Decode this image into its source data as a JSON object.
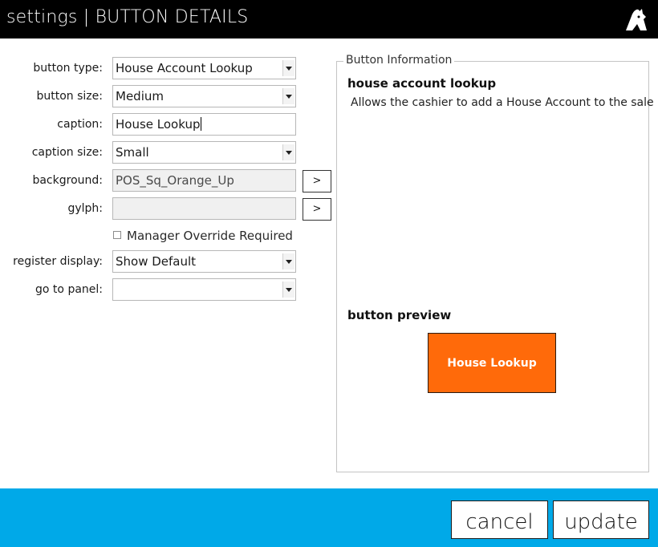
{
  "header": {
    "title": "settings | BUTTON DETAILS",
    "logo_icon": "brand-logo-icon"
  },
  "form": {
    "button_type": {
      "label": "button type:",
      "value": "House Account Lookup"
    },
    "button_size": {
      "label": "button size:",
      "value": "Medium"
    },
    "caption": {
      "label": "caption:",
      "value": "House Lookup"
    },
    "caption_size": {
      "label": "caption size:",
      "value": "Small"
    },
    "background": {
      "label": "background:",
      "value": "POS_Sq_Orange_Up",
      "browse_label": ">"
    },
    "glyph": {
      "label": "gylph:",
      "value": "",
      "browse_label": ">"
    },
    "manager_override": {
      "label": "Manager Override Required",
      "checked": false
    },
    "register_display": {
      "label": "register display:",
      "value": "Show Default"
    },
    "go_to_panel": {
      "label": "go to panel:",
      "value": ""
    }
  },
  "info": {
    "legend": "Button Information",
    "heading": "house account lookup",
    "description": "Allows the cashier to add a House Account to the sale"
  },
  "preview": {
    "heading": "button preview",
    "caption": "House Lookup",
    "color": "#ff6a0a"
  },
  "footer": {
    "cancel_label": "cancel",
    "update_label": "update",
    "color": "#00a9e8"
  }
}
